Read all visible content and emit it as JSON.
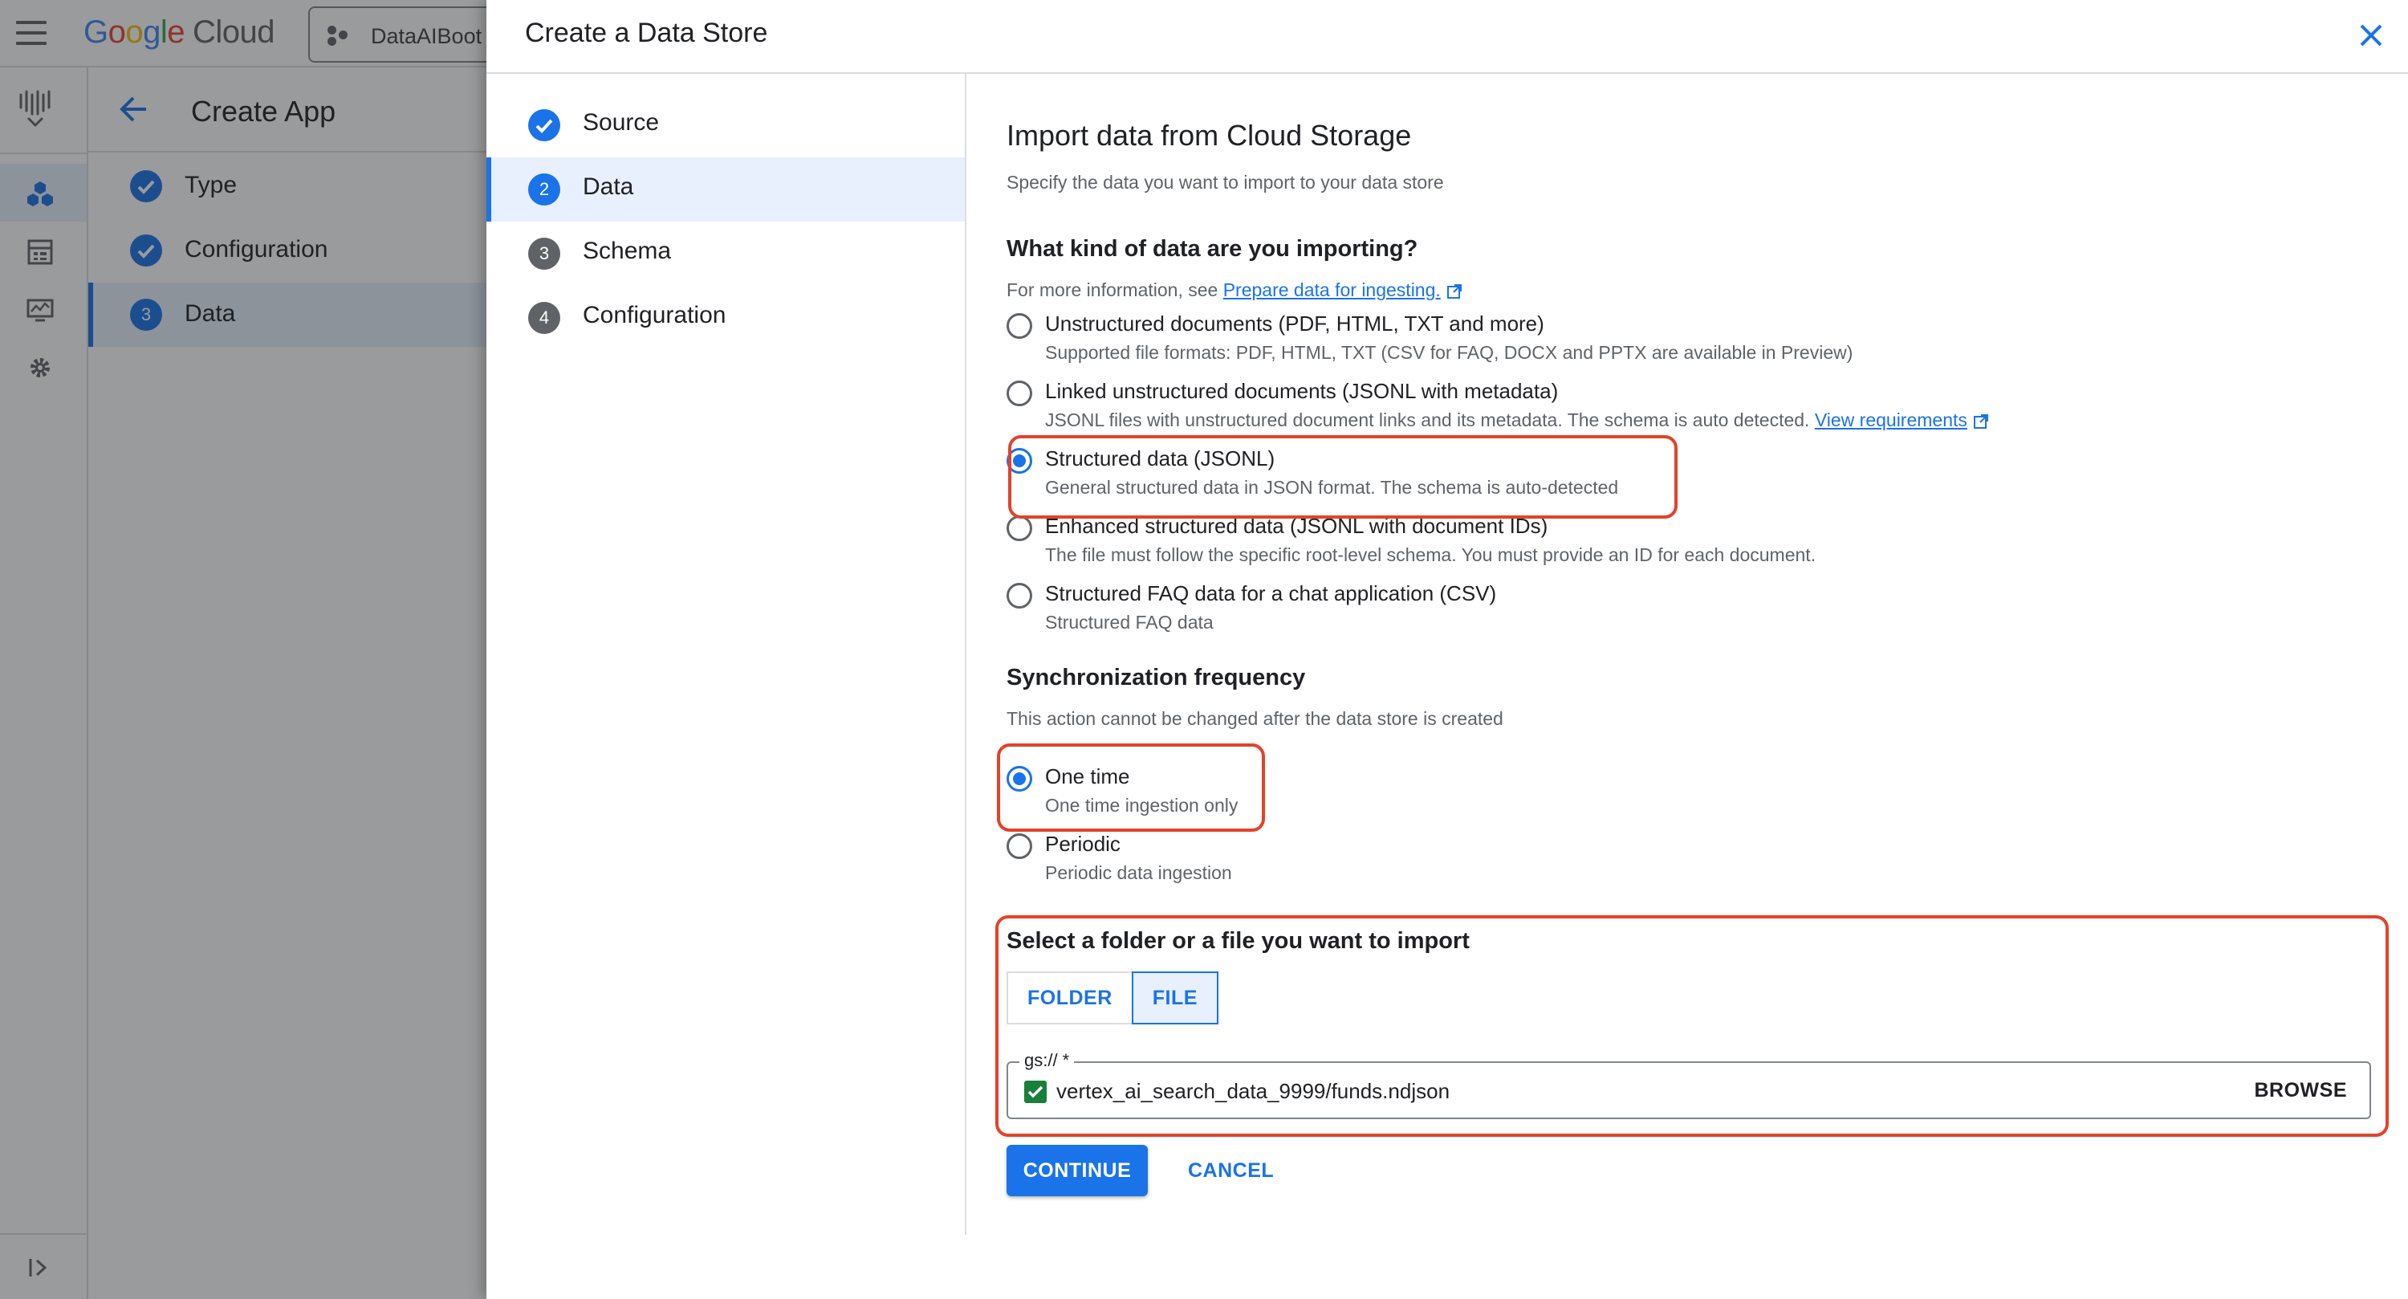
{
  "background": {
    "logo": {
      "google": "Google",
      "cloud": "Cloud"
    },
    "project": "DataAIBoot",
    "app_title": "Create App",
    "steps": [
      {
        "label": "Type",
        "state": "done"
      },
      {
        "label": "Configuration",
        "state": "done"
      },
      {
        "label": "Data",
        "number": "3",
        "state": "current"
      }
    ]
  },
  "dialog": {
    "title": "Create a Data Store",
    "steps": [
      {
        "label": "Source",
        "state": "done"
      },
      {
        "label": "Data",
        "number": "2",
        "state": "current"
      },
      {
        "label": "Schema",
        "number": "3",
        "state": "todo"
      },
      {
        "label": "Configuration",
        "number": "4",
        "state": "todo"
      }
    ],
    "heading": "Import data from Cloud Storage",
    "subheading": "Specify the data you want to import to your data store",
    "kind_question": "What kind of data are you importing?",
    "more_info_prefix": "For more information, see ",
    "more_info_link": "Prepare data for ingesting.",
    "data_kinds": [
      {
        "title": "Unstructured documents (PDF, HTML, TXT and more)",
        "desc": "Supported file formats: PDF, HTML, TXT (CSV for FAQ, DOCX and PPTX are available in Preview)",
        "checked": false
      },
      {
        "title": "Linked unstructured documents (JSONL with metadata)",
        "desc": "JSONL files with unstructured document links and its metadata. The schema is auto detected. ",
        "link": "View requirements",
        "checked": false
      },
      {
        "title": "Structured data (JSONL)",
        "desc": "General structured data in JSON format. The schema is auto-detected",
        "checked": true
      },
      {
        "title": "Enhanced structured data (JSONL with document IDs)",
        "desc": "The file must follow the specific root-level schema. You must provide an ID for each document.",
        "checked": false
      },
      {
        "title": "Structured FAQ data for a chat application (CSV)",
        "desc": "Structured FAQ data",
        "checked": false
      }
    ],
    "sync_heading": "Synchronization frequency",
    "sync_note": "This action cannot be changed after the data store is created",
    "sync_options": [
      {
        "title": "One time",
        "desc": "One time ingestion only",
        "checked": true
      },
      {
        "title": "Periodic",
        "desc": "Periodic data ingestion",
        "checked": false
      }
    ],
    "select_heading": "Select a folder or a file you want to import",
    "toggle": {
      "folder": "FOLDER",
      "file": "FILE",
      "selected": "file"
    },
    "gs_label": "gs:// *",
    "gs_value": "vertex_ai_search_data_9999/funds.ndjson",
    "browse": "BROWSE",
    "continue": "CONTINUE",
    "cancel": "CANCEL"
  },
  "colors": {
    "accent": "#1a73e8",
    "annotation": "#e2432a",
    "check": "#188038"
  },
  "icons": [
    "menu-icon",
    "project-icon",
    "agent-builder-icon",
    "apps-icon",
    "data-stores-icon",
    "monitoring-icon",
    "settings-icon",
    "expand-icon",
    "back-arrow-icon",
    "close-icon",
    "check-icon",
    "external-link-icon"
  ]
}
